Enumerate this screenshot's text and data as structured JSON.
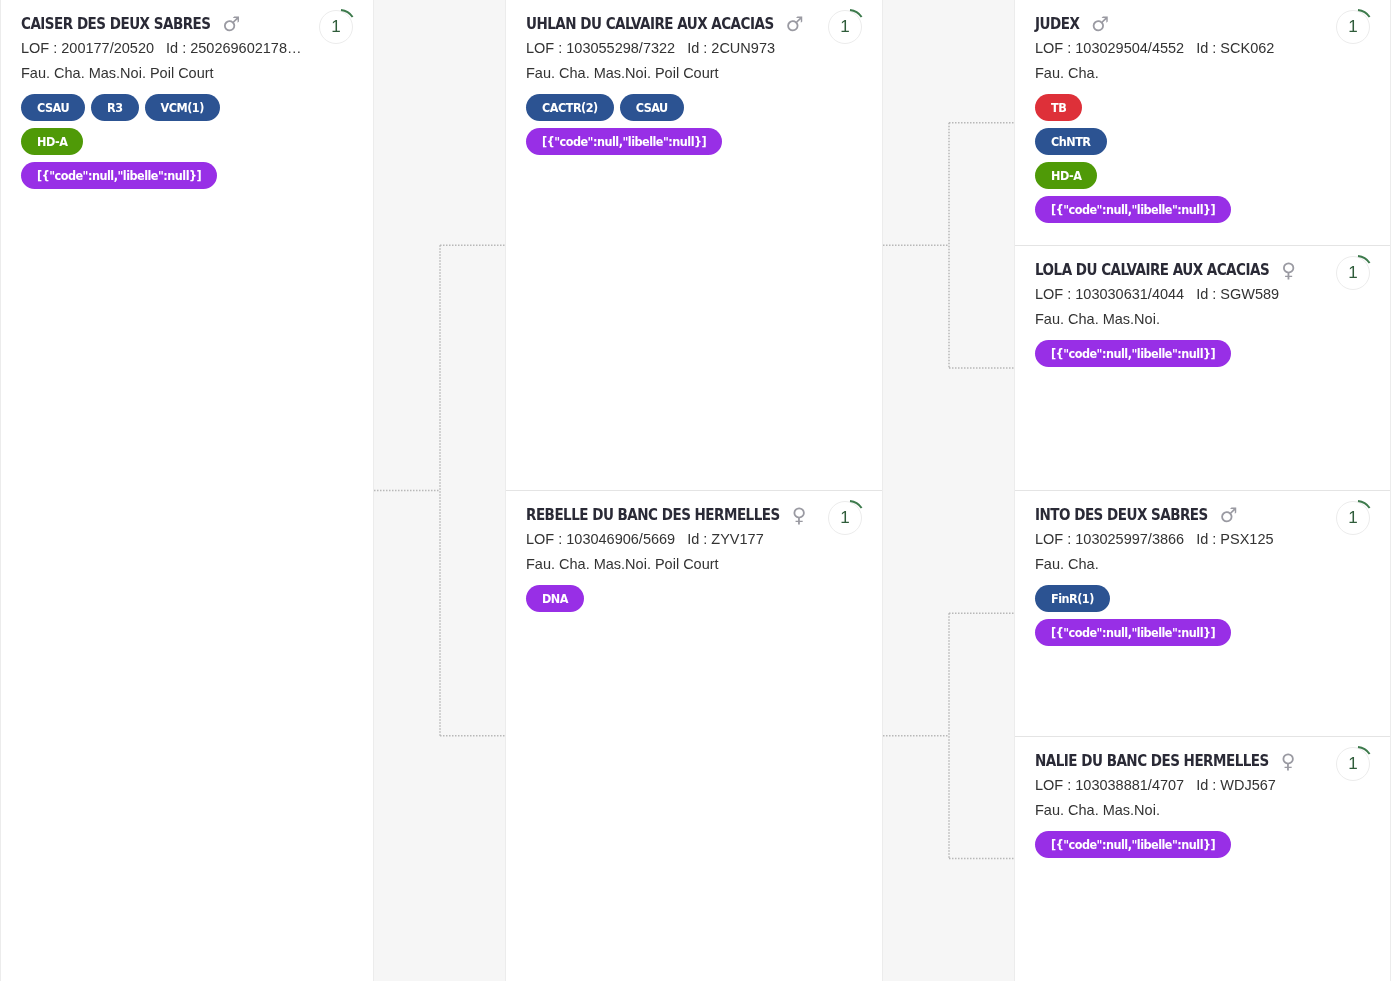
{
  "generations": [
    {
      "dogs": [
        {
          "name": "CAISER DES DEUX SABRES",
          "sex": "♂",
          "lof": "LOF : 200177/20520",
          "id": "Id : 250269602178…",
          "coat": "Fau. Cha. Mas.Noi. Poil Court",
          "count": "1",
          "tag_rows": [
            [
              {
                "label": "CSAU",
                "color": "#2c5392"
              },
              {
                "label": "R3",
                "color": "#2c5392"
              },
              {
                "label": "VCM(1)",
                "color": "#2c5392"
              }
            ],
            [
              {
                "label": "HD-A",
                "color": "#4f9a07"
              }
            ],
            [
              {
                "label": "[{\"code\":null,\"libelle\":null}]",
                "color": "#982fe6"
              }
            ]
          ]
        }
      ]
    },
    {
      "dogs": [
        {
          "name": "UHLAN DU CALVAIRE AUX ACACIAS",
          "sex": "♂",
          "lof": "LOF : 103055298/7322",
          "id": "Id : 2CUN973",
          "coat": "Fau. Cha. Mas.Noi. Poil Court",
          "count": "1",
          "tag_rows": [
            [
              {
                "label": "CACTR(2)",
                "color": "#2c5392"
              },
              {
                "label": "CSAU",
                "color": "#2c5392"
              }
            ],
            [
              {
                "label": "[{\"code\":null,\"libelle\":null}]",
                "color": "#982fe6"
              }
            ]
          ]
        },
        {
          "name": "REBELLE DU BANC DES HERMELLES",
          "sex": "♀",
          "lof": "LOF : 103046906/5669",
          "id": "Id : ZYV177",
          "coat": "Fau. Cha. Mas.Noi. Poil Court",
          "count": "1",
          "tag_rows": [
            [
              {
                "label": "DNA",
                "color": "#982fe6"
              }
            ]
          ]
        }
      ]
    },
    {
      "dogs": [
        {
          "name": "JUDEX",
          "sex": "♂",
          "lof": "LOF : 103029504/4552",
          "id": "Id : SCK062",
          "coat": "Fau. Cha.",
          "count": "1",
          "tag_rows": [
            [
              {
                "label": "TB",
                "color": "#de3039"
              }
            ],
            [
              {
                "label": "ChNTR",
                "color": "#2c5392"
              }
            ],
            [
              {
                "label": "HD-A",
                "color": "#4f9a07"
              }
            ],
            [
              {
                "label": "[{\"code\":null,\"libelle\":null}]",
                "color": "#982fe6"
              }
            ]
          ]
        },
        {
          "name": "LOLA DU CALVAIRE AUX ACACIAS",
          "sex": "♀",
          "lof": "LOF : 103030631/4044",
          "id": "Id : SGW589",
          "coat": "Fau. Cha. Mas.Noi.",
          "count": "1",
          "tag_rows": [
            [
              {
                "label": "[{\"code\":null,\"libelle\":null}]",
                "color": "#982fe6"
              }
            ]
          ]
        },
        {
          "name": "INTO DES DEUX SABRES",
          "sex": "♂",
          "lof": "LOF : 103025997/3866",
          "id": "Id : PSX125",
          "coat": "Fau. Cha.",
          "count": "1",
          "tag_rows": [
            [
              {
                "label": "FinR(1)",
                "color": "#2c5392"
              }
            ],
            [
              {
                "label": "[{\"code\":null,\"libelle\":null}]",
                "color": "#982fe6"
              }
            ]
          ]
        },
        {
          "name": "NALIE DU BANC DES HERMELLES",
          "sex": "♀",
          "lof": "LOF : 103038881/4707",
          "id": "Id : WDJ567",
          "coat": "Fau. Cha. Mas.Noi.",
          "count": "1",
          "tag_rows": [
            [
              {
                "label": "[{\"code\":null,\"libelle\":null}]",
                "color": "#982fe6"
              }
            ]
          ]
        }
      ]
    }
  ]
}
